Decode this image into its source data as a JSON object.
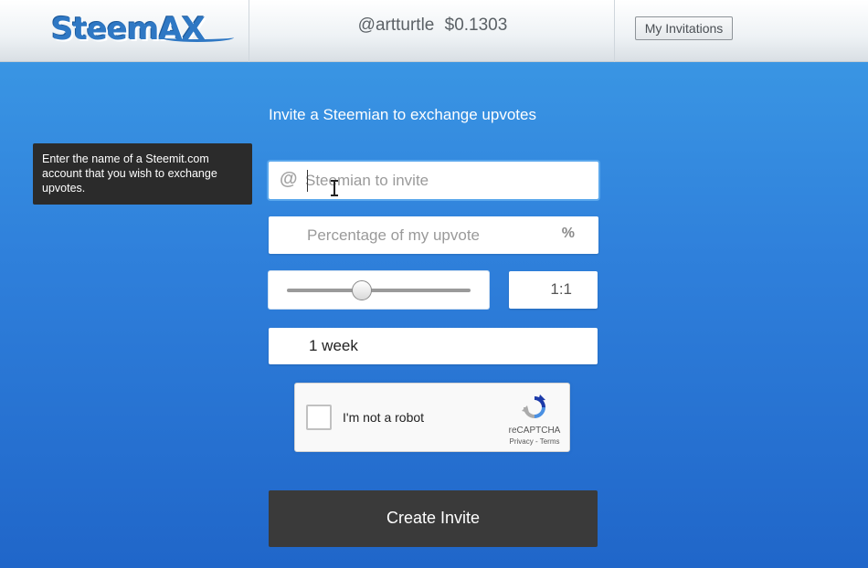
{
  "header": {
    "logo_text": "SteemAX",
    "username": "@artturtle",
    "balance": "$0.1303",
    "nav_button": "My Invitations"
  },
  "form": {
    "title": "Invite a Steemian to exchange upvotes",
    "tooltip": "Enter the name of a Steemit.com account that you wish to exchange upvotes.",
    "steemian_prefix": "@",
    "steemian_placeholder": "Steemian to invite",
    "percentage_placeholder": "Percentage of my upvote",
    "percentage_symbol": "%",
    "ratio": "1:1",
    "slider_level": 0.41,
    "duration": "1 week",
    "captcha": {
      "label": "I'm not a robot",
      "brand": "reCAPTCHA",
      "links": "Privacy - Terms"
    },
    "submit_label": "Create Invite"
  },
  "colors": {
    "background_top": "#3d9ce6",
    "background_bottom": "#2066c9",
    "button_dark": "#3a3a3a",
    "logo_blue": "#2f78c4"
  }
}
